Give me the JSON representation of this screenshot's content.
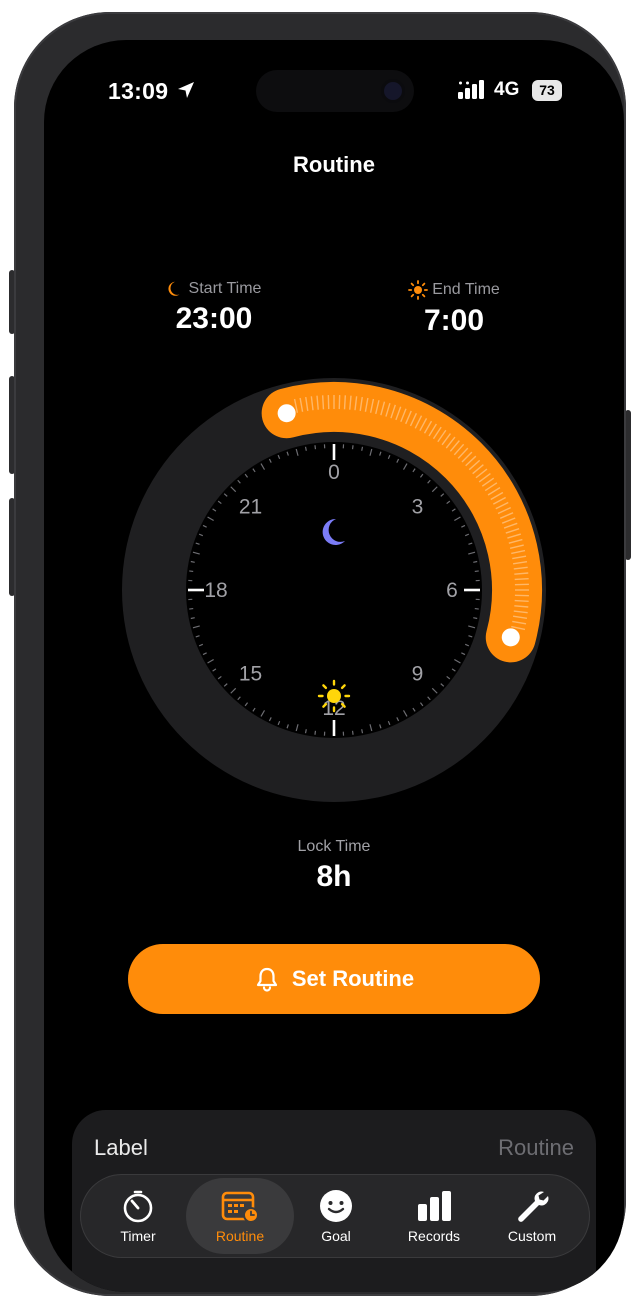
{
  "status": {
    "time": "13:09",
    "network": "4G",
    "battery": "73",
    "icons": [
      "location-arrow-icon",
      "signal-bars-icon"
    ]
  },
  "header": {
    "title": "Routine"
  },
  "schedule": {
    "start": {
      "label": "Start Time",
      "value": "23:00",
      "icon": "moon-icon"
    },
    "end": {
      "label": "End Time",
      "value": "7:00",
      "icon": "sun-icon"
    }
  },
  "dial": {
    "hour_labels": [
      "0",
      "3",
      "6",
      "9",
      "12",
      "15",
      "18",
      "21"
    ],
    "arc_start_hour": 23,
    "arc_end_hour": 7,
    "hours_per_turn": 24,
    "center_icons": [
      "moon-icon",
      "sun-icon"
    ]
  },
  "lock": {
    "label": "Lock Time",
    "value": "8h"
  },
  "action": {
    "label": "Set Routine",
    "icon": "bell-icon"
  },
  "sheet": {
    "label": "Label",
    "value": "Routine"
  },
  "tabs": [
    {
      "label": "Timer",
      "icon": "stopwatch-icon",
      "active": false
    },
    {
      "label": "Routine",
      "icon": "calendar-clock-icon",
      "active": true
    },
    {
      "label": "Goal",
      "icon": "smiley-icon",
      "active": false
    },
    {
      "label": "Records",
      "icon": "bar-chart-icon",
      "active": false
    },
    {
      "label": "Custom",
      "icon": "wrench-icon",
      "active": false
    }
  ],
  "colors": {
    "accent": "#ff8c0a",
    "moon": "#7b7cf7",
    "sun": "#ffd60a",
    "ring": "#1f1f21",
    "face": "#000000"
  }
}
